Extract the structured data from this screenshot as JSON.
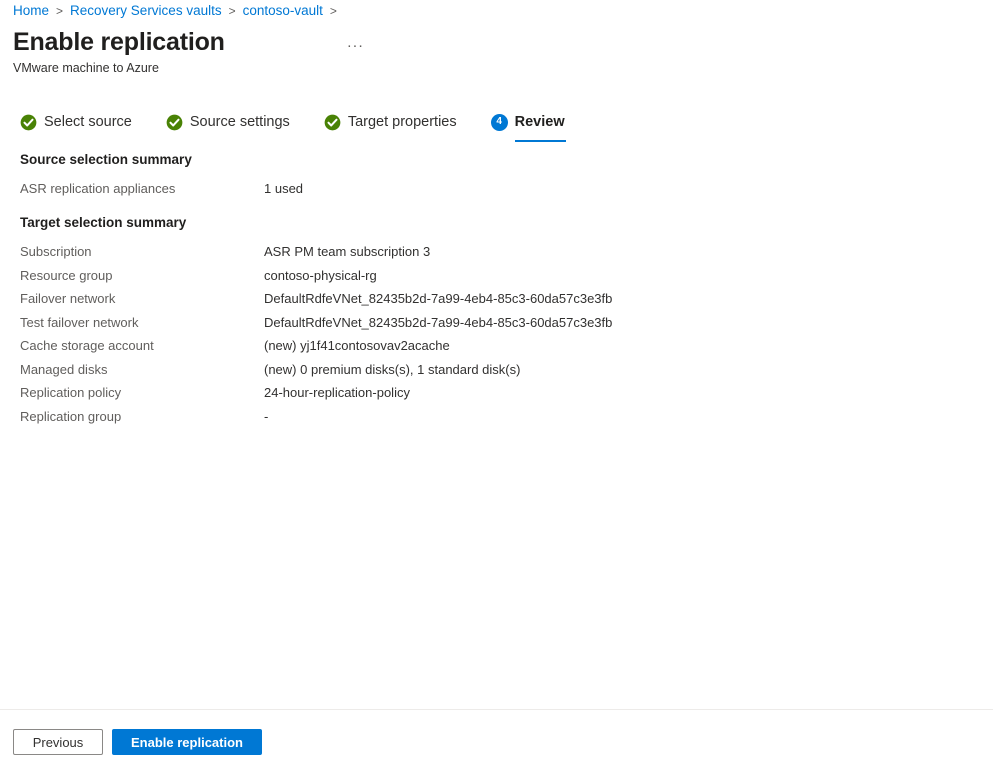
{
  "breadcrumb": {
    "items": [
      {
        "label": "Home"
      },
      {
        "label": "Recovery Services vaults"
      },
      {
        "label": "contoso-vault"
      }
    ],
    "separator": ">"
  },
  "header": {
    "title": "Enable replication",
    "subtitle": "VMware machine to Azure",
    "more_label": "..."
  },
  "wizard": {
    "tabs": [
      {
        "label": "Select source",
        "state": "complete",
        "icon": "check-circle-icon"
      },
      {
        "label": "Source settings",
        "state": "complete",
        "icon": "check-circle-icon"
      },
      {
        "label": "Target properties",
        "state": "complete",
        "icon": "check-circle-icon"
      },
      {
        "label": "Review",
        "state": "active",
        "number": "4"
      }
    ]
  },
  "sections": [
    {
      "title": "Source selection summary",
      "rows": [
        {
          "key": "ASR replication appliances",
          "value": "1 used"
        }
      ]
    },
    {
      "title": "Target selection summary",
      "rows": [
        {
          "key": "Subscription",
          "value": "ASR PM team subscription 3"
        },
        {
          "key": "Resource group",
          "value": "contoso-physical-rg"
        },
        {
          "key": "Failover network",
          "value": "DefaultRdfeVNet_82435b2d-7a99-4eb4-85c3-60da57c3e3fb"
        },
        {
          "key": "Test failover network",
          "value": "DefaultRdfeVNet_82435b2d-7a99-4eb4-85c3-60da57c3e3fb"
        },
        {
          "key": "Cache storage account",
          "value": "(new) yj1f41contosovav2acache"
        },
        {
          "key": "Managed disks",
          "value": "(new) 0 premium disks(s), 1 standard disk(s)"
        },
        {
          "key": "Replication policy",
          "value": "24-hour-replication-policy"
        },
        {
          "key": "Replication group",
          "value": "-"
        }
      ]
    }
  ],
  "footer": {
    "previous_label": "Previous",
    "submit_label": "Enable replication"
  },
  "colors": {
    "accent": "#0078d4",
    "success": "#498205",
    "link": "#0078d4",
    "text": "#323130",
    "muted": "#605e5c",
    "divider": "#edebe9"
  }
}
